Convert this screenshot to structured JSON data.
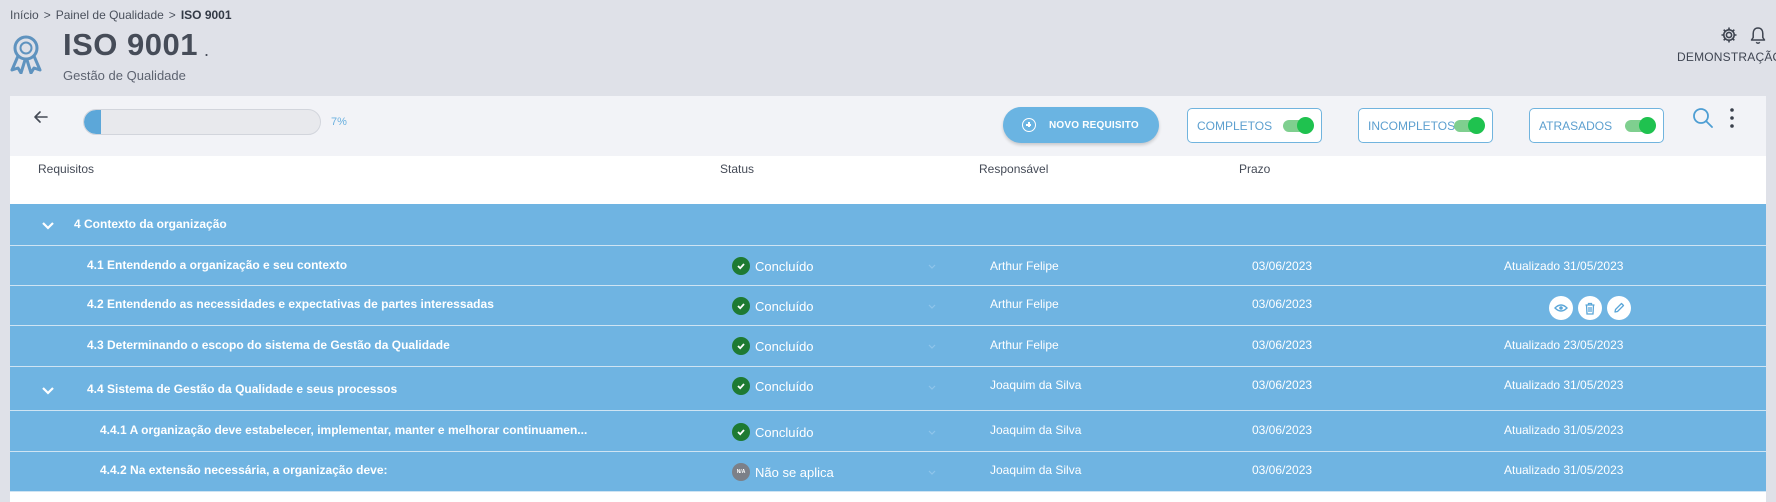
{
  "breadcrumb": {
    "home": "Início",
    "sep": ">",
    "dashboard": "Painel de Qualidade",
    "current": "ISO 9001"
  },
  "header": {
    "title": "ISO 9001",
    "title_dot": ".",
    "subtitle": "Gestão de Qualidade",
    "user": "DEMONSTRAÇÃO"
  },
  "toolbar": {
    "progress": 7,
    "progress_label": "7%",
    "new_button": "NOVO REQUISITO",
    "filters": [
      {
        "label": "COMPLETOS",
        "enabled": true
      },
      {
        "label": "INCOMPLETOS",
        "enabled": true
      },
      {
        "label": "ATRASADOS",
        "enabled": true
      }
    ]
  },
  "columns": {
    "requirements": "Requisitos",
    "status": "Status",
    "owner": "Responsável",
    "deadline": "Prazo"
  },
  "rows": [
    {
      "title": "4 Contexto da organização",
      "group": true
    },
    {
      "title": "4.1 Entendendo a organização e seu contexto",
      "status": "Concluído",
      "owner": "Arthur Felipe",
      "deadline": "03/06/2023",
      "updated": "Atualizado 31/05/2023"
    },
    {
      "title": "4.2 Entendendo as necessidades e expectativas de partes interessadas",
      "status": "Concluído",
      "owner": "Arthur Felipe",
      "deadline": "03/06/2023",
      "updated": ""
    },
    {
      "title": "4.3 Determinando o escopo do sistema de Gestão da Qualidade",
      "status": "Concluído",
      "owner": "Arthur Felipe",
      "deadline": "03/06/2023",
      "updated": "Atualizado 23/05/2023"
    },
    {
      "title": "4.4 Sistema de Gestão da Qualidade e seus processos",
      "status": "Concluído",
      "owner": "Joaquim da Silva",
      "deadline": "03/06/2023",
      "updated": "Atualizado 31/05/2023"
    },
    {
      "title": "4.4.1 A organização deve estabelecer, implementar, manter e melhorar continuamen...",
      "status": "Concluído",
      "owner": "Joaquim da Silva",
      "deadline": "03/06/2023",
      "updated": "Atualizado 31/05/2023"
    },
    {
      "title": "4.4.2 Na extensão necessária, a organização deve:",
      "status": "Não se aplica",
      "status_badge": "N/A",
      "owner": "Joaquim da Silva",
      "deadline": "03/06/2023",
      "updated": "Atualizado 31/05/2023"
    }
  ],
  "icons": {
    "page": "award-ribbon-icon",
    "settings": "gear-icon",
    "notifications": "bell-icon",
    "back": "arrow-left-icon",
    "search": "search-icon",
    "more": "kebab-menu-icon",
    "view": "eye-icon",
    "delete": "trash-icon",
    "edit": "pencil-icon"
  },
  "colors": {
    "accent": "#6fb4e2",
    "success": "#1e7a32",
    "toggle_on": "#1fc24f",
    "background": "#dfe1e8"
  }
}
